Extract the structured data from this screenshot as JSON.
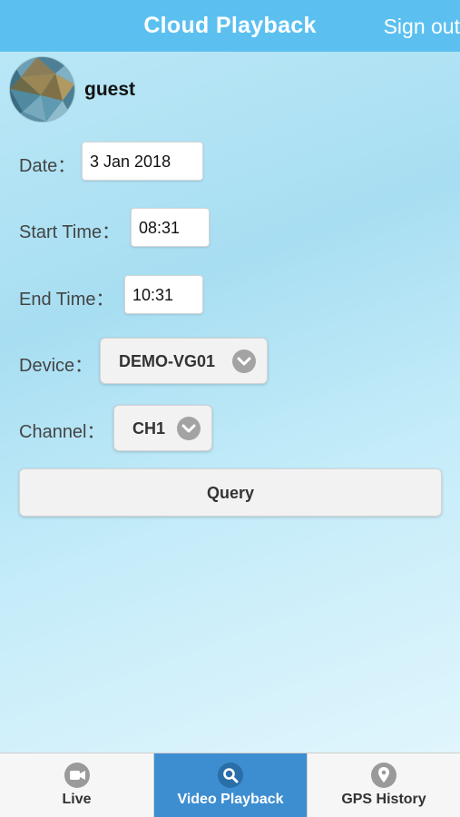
{
  "header": {
    "title": "Cloud Playback",
    "signout_label": "Sign out"
  },
  "user": {
    "name": "guest"
  },
  "form": {
    "date_label": "Date：",
    "date_value": "3 Jan 2018",
    "start_label": "Start Time：",
    "start_value": "08:31",
    "end_label": "End Time：",
    "end_value": "10:31",
    "device_label": "Device：",
    "device_value": "DEMO-VG01",
    "channel_label": "Channel：",
    "channel_value": "CH1",
    "query_label": "Query"
  },
  "tabs": [
    {
      "label": "Live",
      "icon": "video-camera-icon",
      "active": false
    },
    {
      "label": "Video Playback",
      "icon": "search-icon",
      "active": true
    },
    {
      "label": "GPS History",
      "icon": "location-pin-icon",
      "active": false
    }
  ],
  "colors": {
    "header": "#5bc0f0",
    "active_tab": "#3d8ed0"
  }
}
